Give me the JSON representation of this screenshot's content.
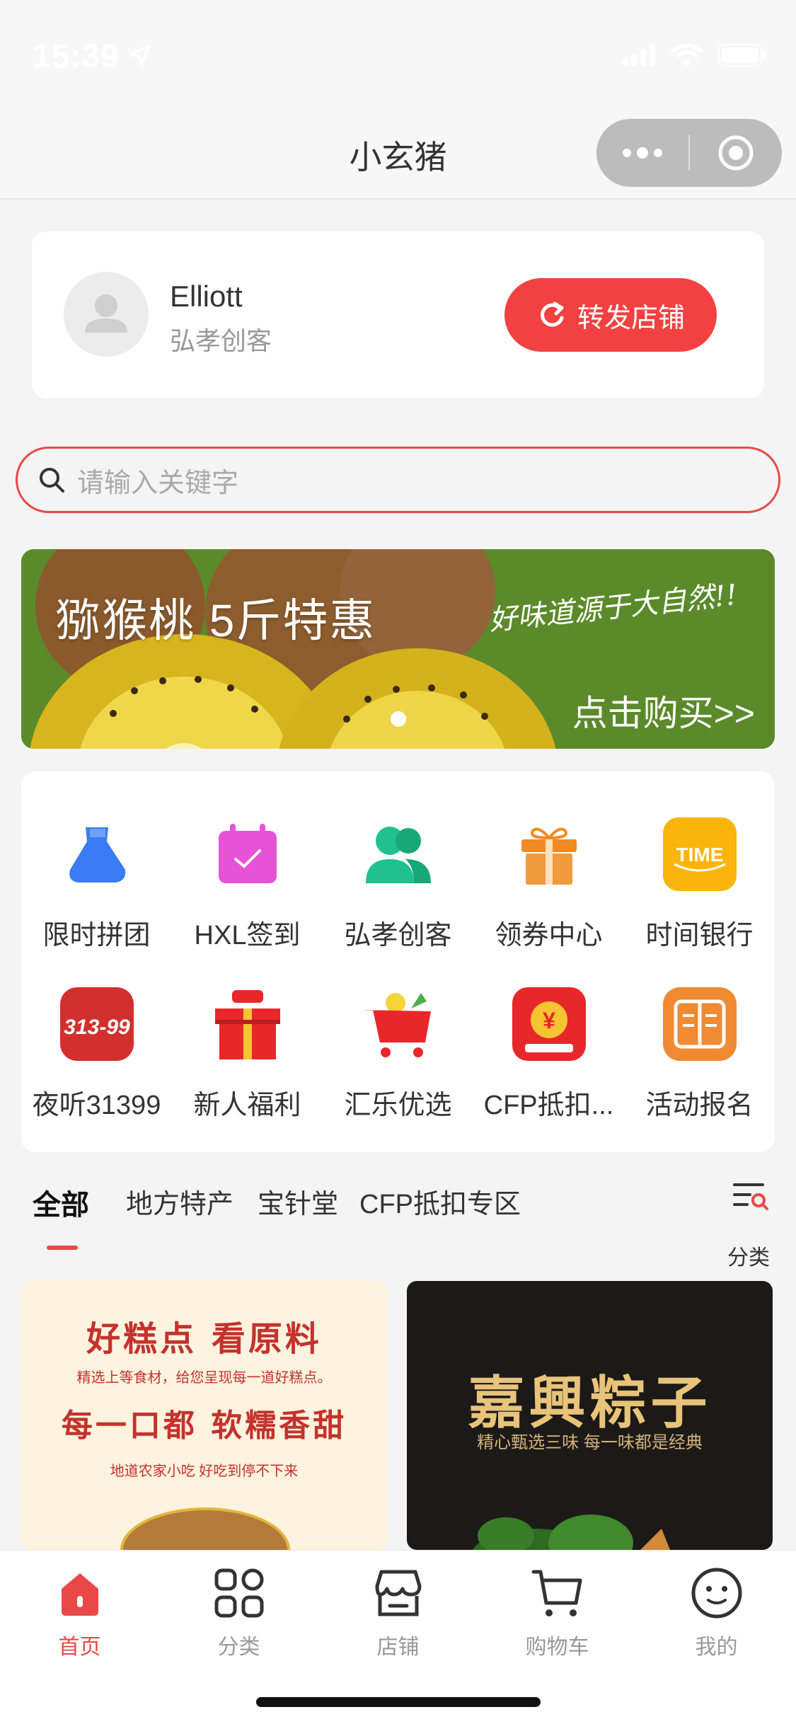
{
  "status_bar": {
    "time": "15:39"
  },
  "nav": {
    "title": "小玄猪"
  },
  "profile": {
    "name": "Elliott",
    "role": "弘孝创客",
    "share_label": "转发店铺"
  },
  "search": {
    "placeholder": "请输入关键字"
  },
  "banner": {
    "title": "猕猴桃 5斤特惠",
    "slogan": "好味道源于大自然!!",
    "cta": "点击购买>>",
    "slide_count": 1,
    "active_slide": 1
  },
  "grid": {
    "items": [
      {
        "label": "限时拼团",
        "icon": "group-buy-icon",
        "color": "#3b7bf6"
      },
      {
        "label": "HXL签到",
        "icon": "calendar-checkin-icon",
        "color": "#e653d6"
      },
      {
        "label": "弘孝创客",
        "icon": "users-icon",
        "color": "#1fc28c"
      },
      {
        "label": "领券中心",
        "icon": "gift-icon",
        "color": "#f08a23"
      },
      {
        "label": "时间银行",
        "icon": "time-bank-icon",
        "color": "#f9b50c"
      },
      {
        "label": "夜听31399",
        "icon": "night-listen-icon",
        "color": "#d42f2f"
      },
      {
        "label": "新人福利",
        "icon": "new-user-gift-icon",
        "color": "#e8272b"
      },
      {
        "label": "汇乐优选",
        "icon": "shopping-cart-icon",
        "color": "#e8272b"
      },
      {
        "label": "CFP抵扣...",
        "icon": "cfp-coupon-icon",
        "color": "#e8272b"
      },
      {
        "label": "活动报名",
        "icon": "signup-book-icon",
        "color": "#f08a33"
      }
    ]
  },
  "tabs": {
    "items": [
      "全部",
      "地方特产",
      "宝针堂",
      "CFP抵扣专区"
    ],
    "active": "全部",
    "filter_label": "分类"
  },
  "products": [
    {
      "title": "好糕点 看原料",
      "subtitle": "精选上等食材，给您呈现每一道好糕点。",
      "title2": "每一口都 软糯香甜",
      "subtitle2": "地道农家小吃 好吃到停不下来"
    },
    {
      "title": "嘉興粽子",
      "subtitle": "精心甄选三味 每一味都是经典"
    }
  ],
  "tabbar": {
    "items": [
      {
        "label": "首页",
        "icon": "home-icon"
      },
      {
        "label": "分类",
        "icon": "category-grid-icon"
      },
      {
        "label": "店铺",
        "icon": "store-icon"
      },
      {
        "label": "购物车",
        "icon": "cart-icon"
      },
      {
        "label": "我的",
        "icon": "profile-smile-icon"
      }
    ],
    "active": "首页"
  },
  "colors": {
    "accent": "#e94848",
    "share_button": "#f24141",
    "banner_green": "#5f8d2c"
  }
}
